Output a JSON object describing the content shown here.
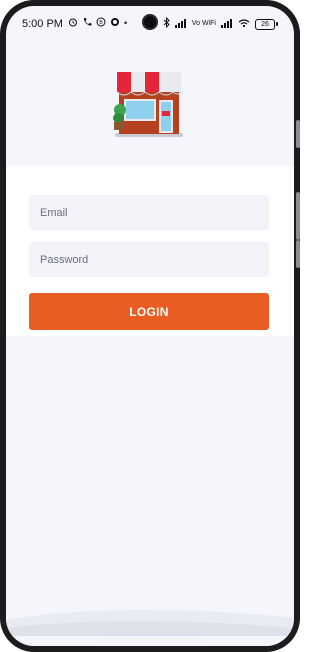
{
  "status_bar": {
    "time": "5:00 PM",
    "left_icons": [
      "alarm-icon",
      "phone-call-icon",
      "b-badge-icon",
      "whatsapp-icon",
      "dot-icon"
    ],
    "right_icons": [
      "bluetooth-icon",
      "signal-icon",
      "vowifi-label",
      "signal-icon-2",
      "wifi-icon",
      "battery-icon"
    ],
    "vowifi": "Vo WiFi",
    "battery": "26"
  },
  "hero": {
    "logo": "store-illustration"
  },
  "form": {
    "email_placeholder": "Email",
    "password_placeholder": "Password",
    "login_label": "LOGIN"
  },
  "colors": {
    "accent": "#ea5d22",
    "background": "#f4f6fb",
    "field_bg": "#f1f3f8",
    "awning_red": "#e4253a",
    "awning_white": "#e8eaf0"
  }
}
